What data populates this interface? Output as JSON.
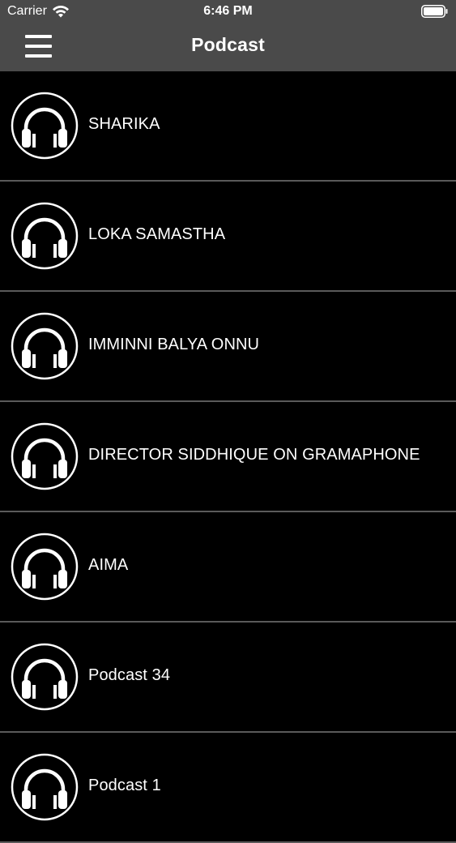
{
  "status_bar": {
    "carrier": "Carrier",
    "time": "6:46 PM",
    "wifi_icon": "wifi-icon",
    "battery_icon": "battery-icon"
  },
  "nav_bar": {
    "title": "Podcast",
    "menu_icon": "hamburger-menu-icon",
    "background_color": "#4a4a4a"
  },
  "list": {
    "item_icon": "headphones-icon",
    "items": [
      {
        "label": "SHARIKA"
      },
      {
        "label": "LOKA SAMASTHA"
      },
      {
        "label": "IMMINNI BALYA ONNU"
      },
      {
        "label": "DIRECTOR SIDDHIQUE ON GRAMAPHONE"
      },
      {
        "label": "AIMA"
      },
      {
        "label": "Podcast 34"
      },
      {
        "label": "Podcast 1"
      }
    ]
  },
  "colors": {
    "background": "#000000",
    "text": "#ffffff",
    "separator": "#5a5a5a"
  }
}
